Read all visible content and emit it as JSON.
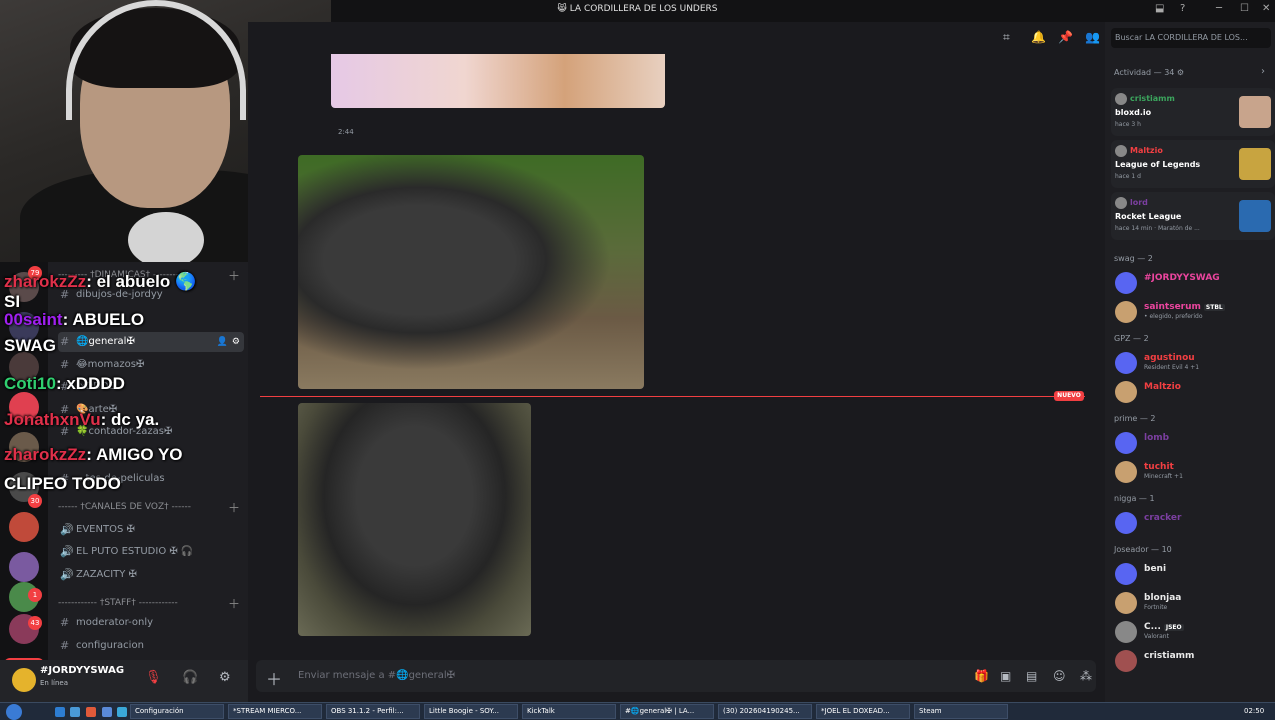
{
  "window": {
    "title": "😸 LA CORDILLERA DE LOS UNDERS"
  },
  "servers": {
    "badges": [
      "79",
      "30",
      "1",
      "43"
    ],
    "new_label": "NUEVO"
  },
  "channels": {
    "items": [
      {
        "type": "category",
        "label": "--------- †DINAMICAS† ----------"
      },
      {
        "type": "text",
        "label": "dibujos-de-jordyy"
      },
      {
        "type": "text",
        "label": "🌐general✠",
        "selected": true
      },
      {
        "type": "text",
        "label": "😂momazos✠"
      },
      {
        "type": "text",
        "label": "-xDDDD"
      },
      {
        "type": "text",
        "label": "🎨arte✠"
      },
      {
        "type": "text",
        "label": "🍀contador-zazas✠"
      },
      {
        "type": "text",
        "label": "...tes-de-peliculas"
      },
      {
        "type": "category",
        "label": "------ †CANALES DE VOZ† ------"
      },
      {
        "type": "voice",
        "label": "EVENTOS ✠"
      },
      {
        "type": "voice",
        "label": "EL PUTO ESTUDIO ✠ 🎧"
      },
      {
        "type": "voice",
        "label": "ZAZACITY ✠"
      },
      {
        "type": "category",
        "label": "------------ †STAFF† ------------"
      },
      {
        "type": "text",
        "label": "moderator-only"
      },
      {
        "type": "text",
        "label": "configuracion"
      }
    ]
  },
  "stream_chat": [
    {
      "user": "zharokzZz",
      "color": "#e0304a",
      "msg": ": el abuelo 🌎"
    },
    {
      "user": "SI",
      "color": "#ffffff",
      "msg": ""
    },
    {
      "user": "00saint",
      "color": "#a020f0",
      "msg": ": ABUELO"
    },
    {
      "user": "SWAG",
      "color": "#ffffff",
      "msg": ""
    },
    {
      "user": "Coti10",
      "color": "#30d070",
      "msg": ": xDDDD"
    },
    {
      "user": "JonathxnVu",
      "color": "#e0304a",
      "msg": ": dc ya."
    },
    {
      "user": "zharokzZz",
      "color": "#e0304a",
      "msg": ": AMIGO YO"
    },
    {
      "user": "CLIPEO TODO",
      "color": "#ffffff",
      "msg": ""
    }
  ],
  "user_panel": {
    "name": "#JORDYYSWAG",
    "status": "En línea"
  },
  "messages": {
    "timestamp": "2:44",
    "new_label": "NUEVO"
  },
  "input": {
    "placeholder": "Enviar mensaje a #🌐general✠"
  },
  "members": {
    "search_placeholder": "Buscar LA CORDILLERA DE LOS...",
    "activity_header": "Actividad — 34 ⚙",
    "activities": [
      {
        "name": "cristiamm",
        "name_color": "#3ba55d",
        "game": "bloxd.io",
        "time": "hace 3 h"
      },
      {
        "name": "Maltzio",
        "name_color": "#f23f42",
        "game": "League of Legends",
        "time": "hace 1 d"
      },
      {
        "name": "lord",
        "name_color": "#7b3fa0",
        "game": "Rocket League",
        "time": "hace 14 min  ·  Maratón de ..."
      }
    ],
    "groups": [
      {
        "header": "swag — 2",
        "members": [
          {
            "name": "#JORDYYSWAG",
            "color": "#eb459e",
            "sub": ""
          },
          {
            "name": "saintserum",
            "color": "#eb459e",
            "tag": "STBL",
            "sub": "• elegido, preferido"
          }
        ]
      },
      {
        "header": "GPZ — 2",
        "members": [
          {
            "name": "agustinou",
            "color": "#f23f42",
            "sub": "Resident Evil 4 +1"
          },
          {
            "name": "Maltzio",
            "color": "#f23f42",
            "sub": ""
          }
        ]
      },
      {
        "header": "prime — 2",
        "members": [
          {
            "name": "lomb",
            "color": "#7b3fa0",
            "sub": ""
          },
          {
            "name": "tuchit",
            "color": "#f23f42",
            "sub": "Minecraft +1"
          }
        ]
      },
      {
        "header": "nigga — 1",
        "members": [
          {
            "name": "cracker",
            "color": "#7b3fa0",
            "sub": ""
          }
        ]
      },
      {
        "header": "Joseador — 10",
        "members": [
          {
            "name": "beni",
            "color": "#eaeaea",
            "sub": ""
          },
          {
            "name": "blonjaa",
            "color": "#eaeaea",
            "sub": "Fortnite"
          },
          {
            "name": "C...",
            "color": "#eaeaea",
            "tag": "JSEO",
            "sub": "Valorant"
          },
          {
            "name": "cristiamm",
            "color": "#eaeaea",
            "sub": ""
          }
        ]
      }
    ]
  },
  "taskbar": {
    "tasks": [
      "Configuración",
      "*STREAM MIERCO...",
      "OBS 31.1.2 - Perfil:...",
      "Little Boogie - SOY...",
      "KickTalk",
      "#🌐general✠ | LA...",
      "(30) 202604190245...",
      "*JOEL EL DOXEAD...",
      "Steam"
    ],
    "clock": "02:50"
  }
}
